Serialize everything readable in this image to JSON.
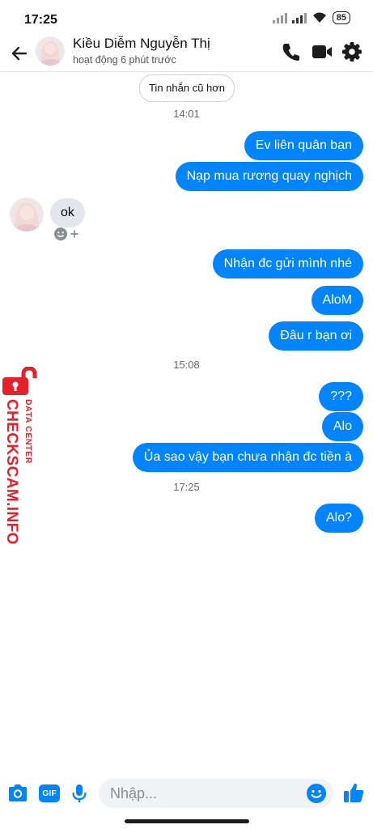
{
  "status_bar": {
    "time": "17:25",
    "battery": "85"
  },
  "header": {
    "contact_name": "Kiều Diễm Nguyễn Thị",
    "contact_status": "hoạt động 6 phút trước"
  },
  "conversation": {
    "older_messages_label": "Tin nhắn cũ hơn",
    "timestamps": [
      "14:01",
      "15:08",
      "17:25"
    ],
    "outgoing_1": [
      "Ev liên quân bạn",
      "Nạp mua rương quay nghịch"
    ],
    "incoming": "ok",
    "outgoing_2": [
      "Nhận đc gửi mình nhé",
      "AloM",
      "Đâu r bạn ơi"
    ],
    "outgoing_3": [
      "???",
      "Alo",
      "Ủa sao vậy bạn chưa nhận đc tiền à"
    ],
    "outgoing_4": [
      "Alo?"
    ]
  },
  "watermark": {
    "line1": "DATA CENTER",
    "line2": "CHECKSCAM.INFO",
    "color": "#e8202a"
  },
  "composer": {
    "placeholder": "Nhập...",
    "gif_label": "GIF"
  },
  "colors": {
    "accent": "#0084ff",
    "incoming_bubble": "#e4e6eb"
  }
}
